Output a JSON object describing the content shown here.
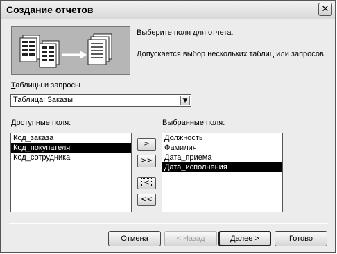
{
  "window": {
    "title": "Создание отчетов",
    "close_symbol": "✕"
  },
  "info": {
    "line1": "Выберите поля для отчета.",
    "line2": "Допускается выбор нескольких таблиц или запросов."
  },
  "tables": {
    "label_first": "Т",
    "label_rest": "аблицы и запросы",
    "selected": "Таблица: Заказы",
    "dropdown_icon": "chevron-down-icon"
  },
  "available": {
    "label_first": "Д",
    "label_rest": "оступные поля:",
    "items": [
      "Код_заказа",
      "Код_покупателя",
      "Код_сотрудника"
    ],
    "selected_index": 1
  },
  "selected_fields": {
    "label_first": "В",
    "label_rest": "ыбранные поля:",
    "items": [
      "Должность",
      "Фамилия",
      "Дата_приема",
      "Дата_исполнения"
    ],
    "selected_index": 3
  },
  "move_buttons": {
    "add_one": ">",
    "add_all": ">>",
    "remove_one": "<",
    "remove_all": "<<"
  },
  "footer": {
    "cancel": "Отмена",
    "back": "< Назад",
    "next_first": "Д",
    "next_rest": "алее >",
    "finish_first": "Г",
    "finish_rest": "отово",
    "back_enabled": false
  }
}
